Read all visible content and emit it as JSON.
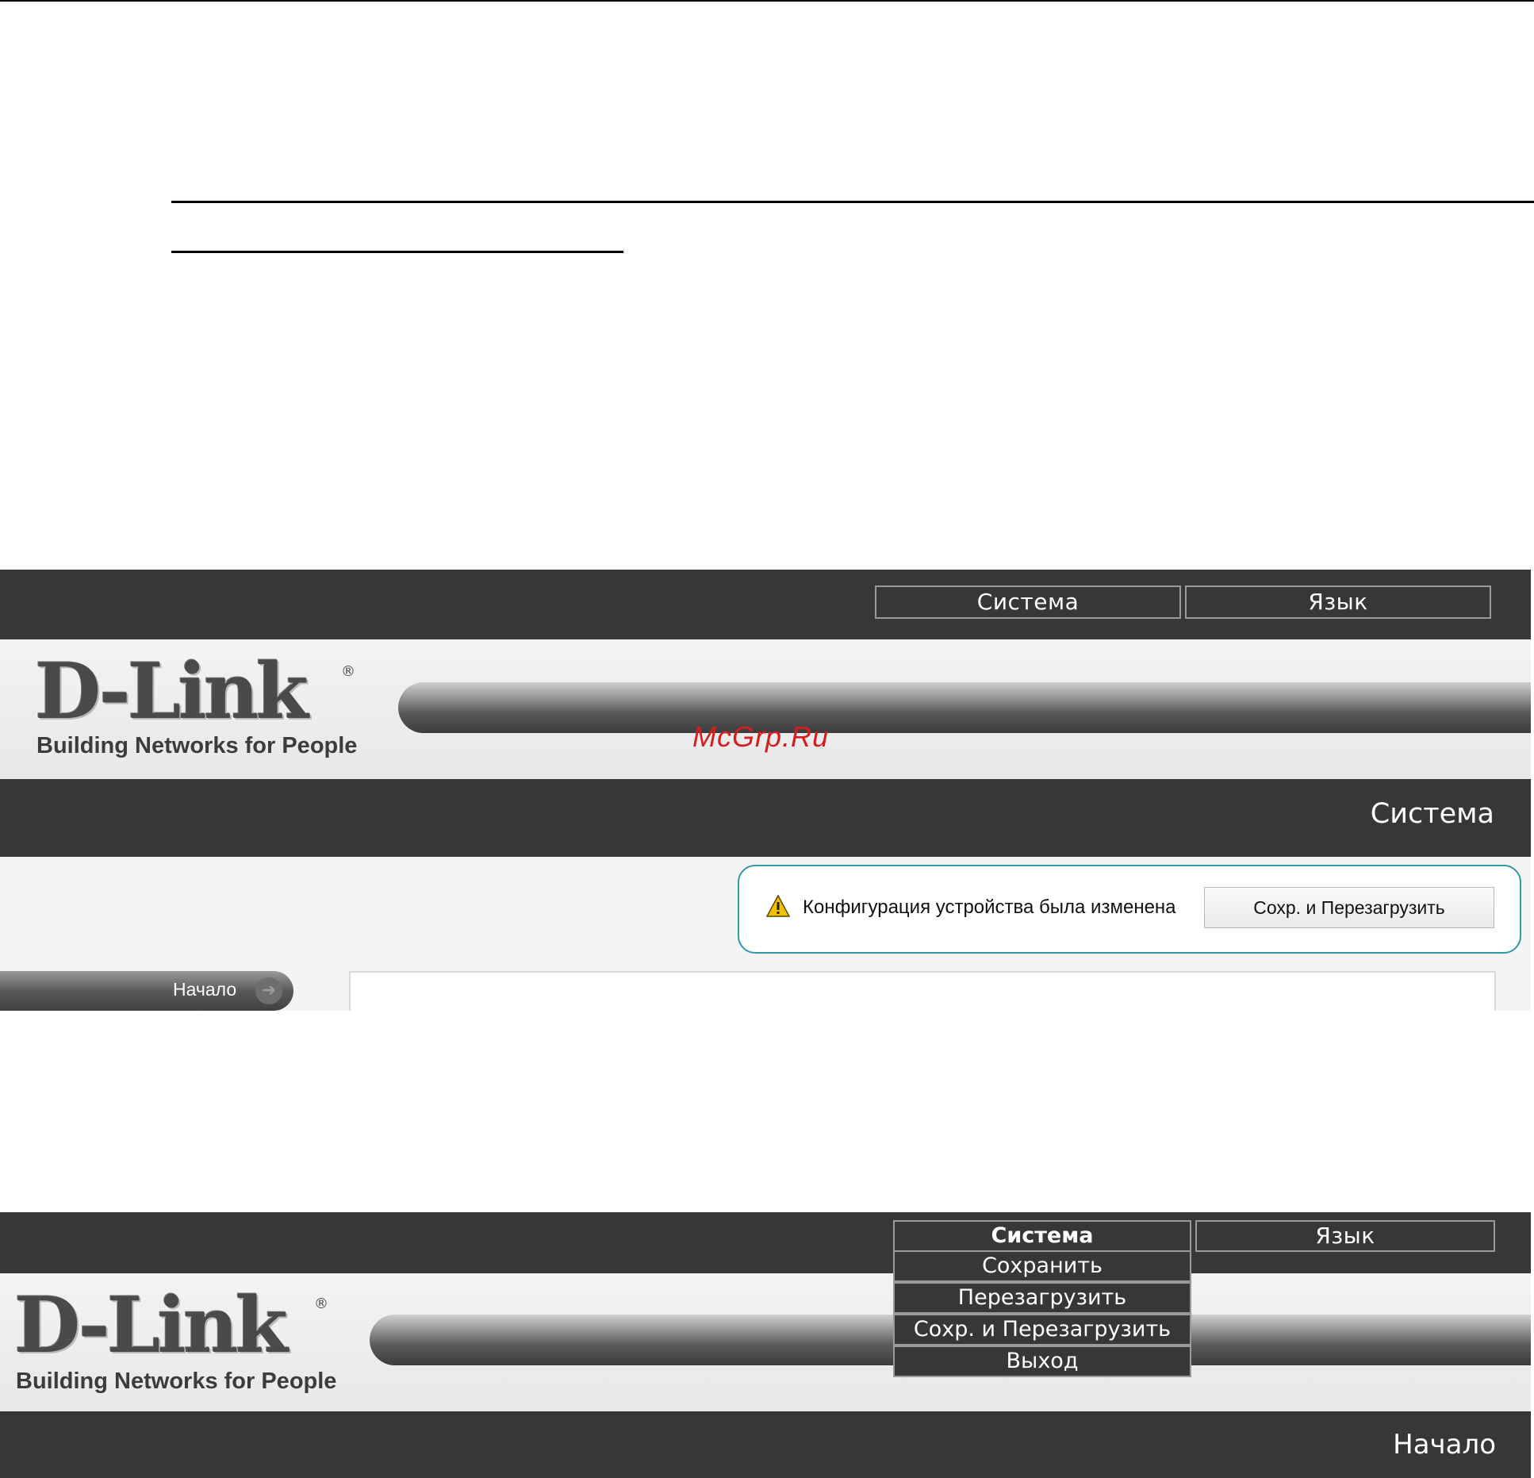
{
  "watermark": "McGrp.Ru",
  "screenshot1": {
    "nav": {
      "system": "Система",
      "language": "Язык"
    },
    "logo": {
      "brand": "D-Link",
      "registered": "®",
      "tagline": "Building Networks for People"
    },
    "page_title": "Система",
    "notice": {
      "icon": "warning-icon",
      "message": "Конфигурация устройства была изменена",
      "button": "Сохр. и Перезагрузить"
    },
    "sidebar": {
      "home": "Начало"
    }
  },
  "screenshot2": {
    "nav": {
      "system": "Система",
      "language": "Язык"
    },
    "system_menu": [
      "Сохранить",
      "Перезагрузить",
      "Сохр. и Перезагрузить",
      "Выход"
    ],
    "logo": {
      "brand": "D-Link",
      "registered": "®",
      "tagline": "Building Networks for People"
    },
    "page_title": "Начало"
  },
  "colors": {
    "bar": "#373739",
    "notice_border": "#2e9ba8",
    "watermark": "#d21f1f"
  }
}
